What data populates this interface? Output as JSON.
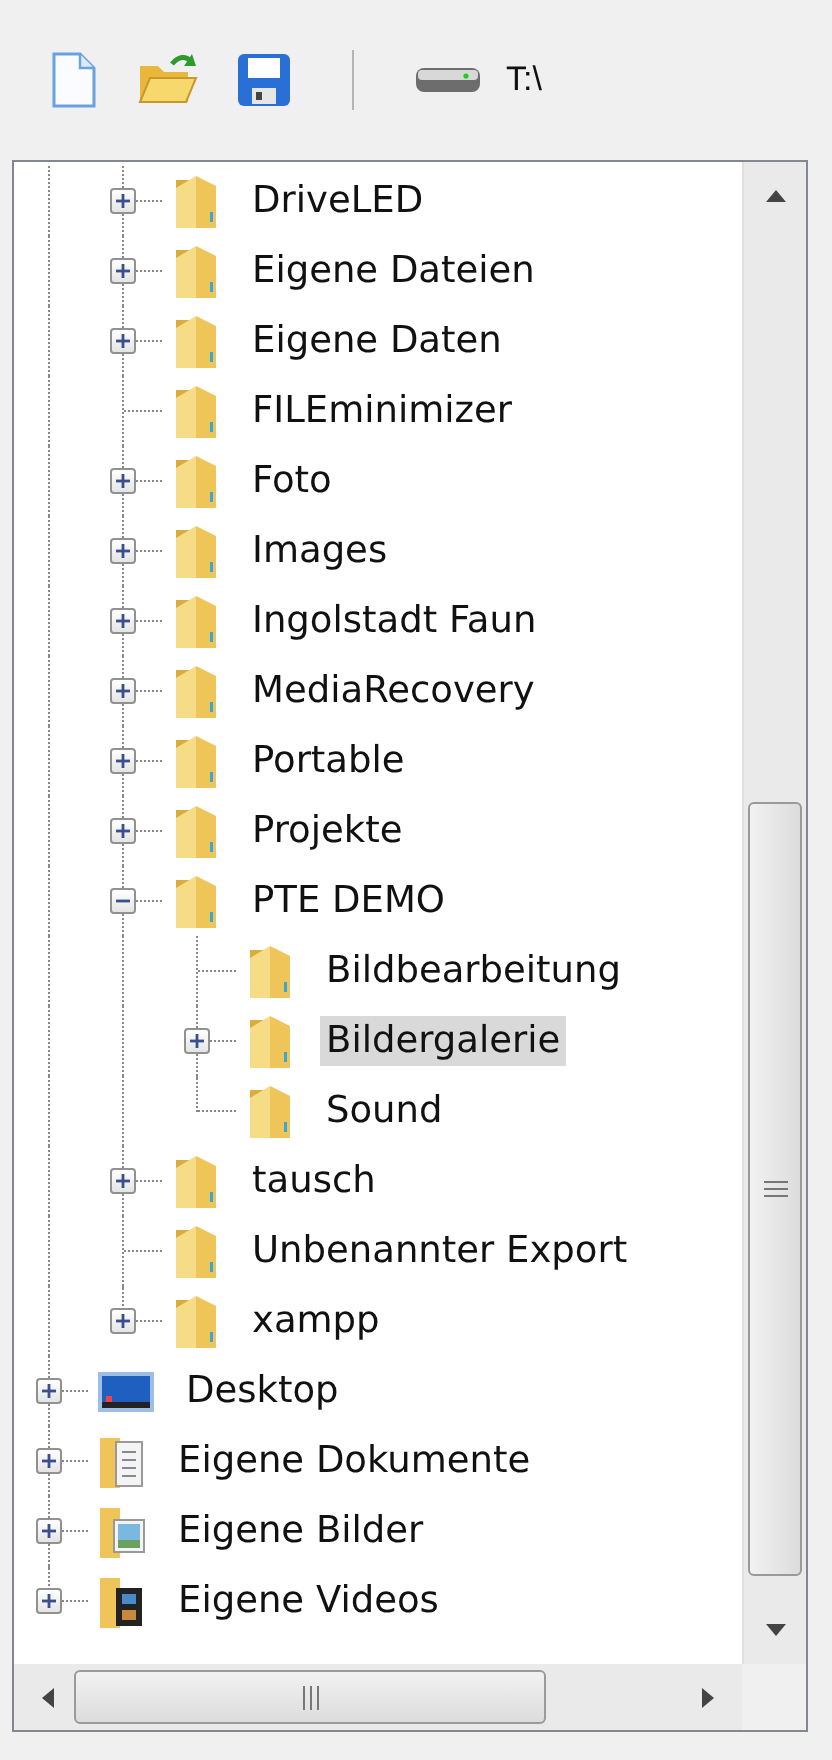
{
  "toolbar": {
    "buttons": [
      {
        "kind": "new"
      },
      {
        "kind": "open"
      },
      {
        "kind": "save"
      }
    ],
    "drive": {
      "label": "T:\\"
    }
  },
  "tree": {
    "partial_branch": [
      {
        "label": "DriveLED",
        "kind": "folder",
        "expandable": true,
        "expanded": false,
        "selected": false
      },
      {
        "label": "Eigene Dateien",
        "kind": "folder",
        "expandable": true,
        "expanded": false,
        "selected": false
      },
      {
        "label": "Eigene Daten",
        "kind": "folder",
        "expandable": true,
        "expanded": false,
        "selected": false
      },
      {
        "label": "FILEminimizer",
        "kind": "folder",
        "expandable": false,
        "selected": false
      },
      {
        "label": "Foto",
        "kind": "folder",
        "expandable": true,
        "expanded": false,
        "selected": false
      },
      {
        "label": "Images",
        "kind": "folder",
        "expandable": true,
        "expanded": false,
        "selected": false
      },
      {
        "label": "Ingolstadt Faun",
        "kind": "folder",
        "expandable": true,
        "expanded": false,
        "selected": false
      },
      {
        "label": "MediaRecovery",
        "kind": "folder",
        "expandable": true,
        "expanded": false,
        "selected": false
      },
      {
        "label": "Portable",
        "kind": "folder",
        "expandable": true,
        "expanded": false,
        "selected": false
      },
      {
        "label": "Projekte",
        "kind": "folder",
        "expandable": true,
        "expanded": false,
        "selected": false
      },
      {
        "label": "PTE DEMO",
        "kind": "folder",
        "expandable": true,
        "expanded": true,
        "selected": false,
        "children": [
          {
            "label": "Bildbearbeitung",
            "kind": "folder",
            "expandable": false,
            "selected": false
          },
          {
            "label": "Bildergalerie",
            "kind": "folder",
            "expandable": true,
            "expanded": false,
            "selected": true
          },
          {
            "label": "Sound",
            "kind": "folder",
            "expandable": false,
            "selected": false
          }
        ]
      },
      {
        "label": "tausch",
        "kind": "folder",
        "expandable": true,
        "expanded": false,
        "selected": false
      },
      {
        "label": "Unbenannter Export",
        "kind": "folder",
        "expandable": false,
        "selected": false
      },
      {
        "label": "xampp",
        "kind": "folder",
        "expandable": true,
        "expanded": false,
        "selected": false
      }
    ],
    "items": [
      {
        "label": "Desktop",
        "kind": "desktop",
        "expandable": true,
        "expanded": false,
        "selected": false
      },
      {
        "label": "Eigene Dokumente",
        "kind": "documents",
        "expandable": true,
        "expanded": false,
        "selected": false
      },
      {
        "label": "Eigene Bilder",
        "kind": "pictures",
        "expandable": true,
        "expanded": false,
        "selected": false
      },
      {
        "label": "Eigene Videos",
        "kind": "videos",
        "expandable": true,
        "expanded": false,
        "selected": false
      }
    ]
  }
}
